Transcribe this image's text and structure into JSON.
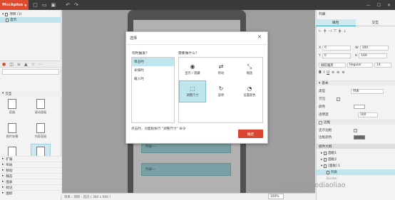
{
  "app": {
    "name": "Mockplus"
  },
  "colors": {
    "brand": "#e24a2f",
    "accent": "#3aa7bd",
    "selection": "#bfe6ee",
    "primary_button": "#d9452f"
  },
  "topbar_icons": [
    "document-icon",
    "folder-icon",
    "save-icon",
    "undo-icon",
    "redo-icon"
  ],
  "tree": {
    "root": "项目 (1)",
    "page": "首页"
  },
  "left_tools": [
    "logo-icon",
    "component-icon",
    "layer-icon",
    "image-icon",
    "star-icon",
    "more-icon"
  ],
  "search": {
    "placeholder": ""
  },
  "sections": {
    "basic": "交互"
  },
  "widgets": [
    {
      "label": "容器"
    },
    {
      "label": "滚动面板"
    },
    {
      "label": "图片轮播"
    },
    {
      "label": "内容面板"
    },
    {
      "label": "滚动区"
    },
    {
      "label": "面板"
    }
  ],
  "categories": [
    "扩展",
    "布局",
    "移动",
    "静态",
    "图表",
    "标记",
    "图标"
  ],
  "canvas": {
    "items": [
      "列表一",
      "列表一"
    ]
  },
  "dialog": {
    "title": "选择",
    "close": "✕",
    "trigger_question": "何时触发？",
    "action_question": "需要做什么？",
    "triggers": [
      "单击时",
      "长按时",
      "载入时"
    ],
    "actions": [
      {
        "label": "显示 / 隐藏",
        "icon": "eye-icon",
        "glyph": "◉"
      },
      {
        "label": "移动",
        "icon": "move-icon",
        "glyph": "⇄"
      },
      {
        "label": "缩放",
        "icon": "scale-icon",
        "glyph": "⤡"
      },
      {
        "label": "调整尺寸",
        "icon": "resize-icon",
        "glyph": "⬚"
      },
      {
        "label": "旋转",
        "icon": "rotate-icon",
        "glyph": "↻"
      },
      {
        "label": "设置颜色",
        "icon": "palette-icon",
        "glyph": "◔"
      }
    ],
    "note": "点击时，对面板执行 “调整尺寸” 命令",
    "ok": "确定"
  },
  "right": {
    "title": "列表",
    "tabs": [
      "属性",
      "交互"
    ],
    "x_label": "X",
    "x_value": "0",
    "w_label": "W",
    "w_value": "300",
    "y_label": "Y",
    "y_value": "0",
    "h_label": "H",
    "h_value": "169",
    "font": "微软雅黑",
    "weight": "Regular",
    "size": "14",
    "basic_section": "基本",
    "type_label": "类型",
    "type_value": "列表",
    "enabled_label": "可见",
    "fill_label": "颜色",
    "opacity_label": "透明度",
    "opacity_value": "100",
    "border_section": "边框",
    "show_label": "显示边框",
    "border_color_label": "边框颜色",
    "outline_title": "组件大纲",
    "outline": [
      "面板1",
      "面板2",
      "[面板] 1",
      "列表",
      "Border"
    ]
  },
  "status": {
    "breadcrumb": "项目 › 项目 › 首页 ( 360 x 640 )",
    "zoom": "100%"
  },
  "watermark": "CSDN @aodiaoliao"
}
